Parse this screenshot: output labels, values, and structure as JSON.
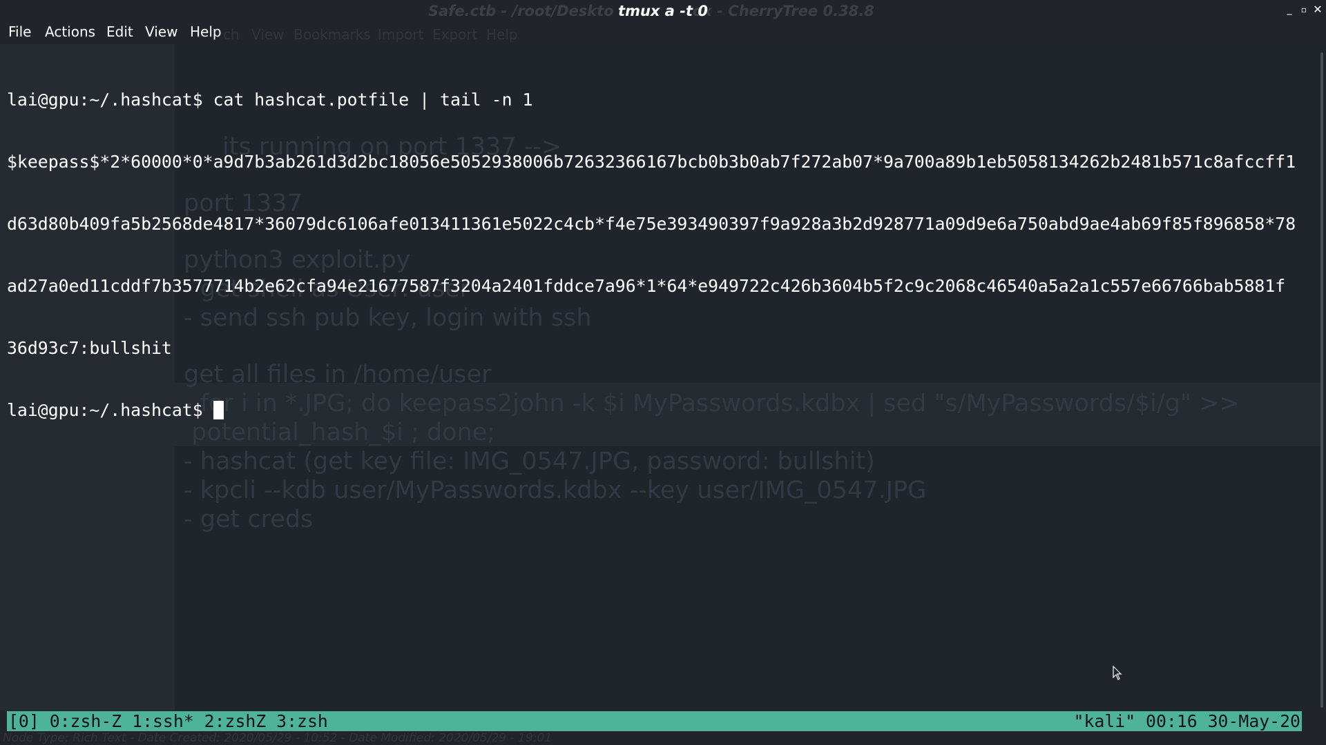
{
  "window": {
    "title": "tmux a -t 0",
    "background_title": "Safe.ctb - /root/Deskto",
    "background_title_tail": "ox - CherryTree 0.38.8"
  },
  "menu": [
    "File",
    "Actions",
    "Edit",
    "View",
    "Help"
  ],
  "background_menu": [
    "ch",
    "View",
    "Bookmarks",
    "Import",
    "Export",
    "Help"
  ],
  "background_notes": [
    "its running on port 1337 -->",
    "port 1337",
    "python3 exploit.py",
    "- get shell as User: user",
    "- send ssh pub key, login with ssh",
    "get all files in /home/user",
    "- for i in *.JPG; do keepass2john -k $i MyPasswords.kdbx | sed \"s/MyPasswords/$i/g\" >>",
    " potential_hash_$i ; done;",
    "- hashcat (get key file: IMG_0547.JPG, password: bullshit)",
    "- kpcli --kdb user/MyPasswords.kdbx --key user/IMG_0547.JPG",
    "- get creds"
  ],
  "background_status": "Node Type: Rich Text  -  Date Created: 2020/05/29 - 10:52  -  Date Modified: 2020/05/29 - 19:01",
  "terminal": {
    "lines": [
      "lai@gpu:~/.hashcat$ cat hashcat.potfile | tail -n 1",
      "$keepass$*2*60000*0*a9d7b3ab261d3d2bc18056e5052938006b72632366167bcb0b3b0ab7f272ab07*9a700a89b1eb5058134262b2481b571c8afccff1",
      "d63d80b409fa5b2568de4817*36079dc6106afe013411361e5022c4cb*f4e75e393490397f9a928a3b2d928771a09d9e6a750abd9ae4ab69f85f896858*78",
      "ad27a0ed11cddf7b3577714b2e62cfa94e21677587f3204a2401fddce7a96*1*64*e949722c426b3604b5f2c9c2068c46540a5a2a1c557e66766bab5881f",
      "36d93c7:bullshit"
    ],
    "prompt": "lai@gpu:~/.hashcat$ "
  },
  "tmux": {
    "left": "[0] 0:zsh-Z 1:ssh* 2:zshZ 3:zsh",
    "right": "\"kali\" 00:16 30-May-20"
  },
  "colors": {
    "terminal_bg": "#232730",
    "tmux_bar": "#4fb39a"
  }
}
